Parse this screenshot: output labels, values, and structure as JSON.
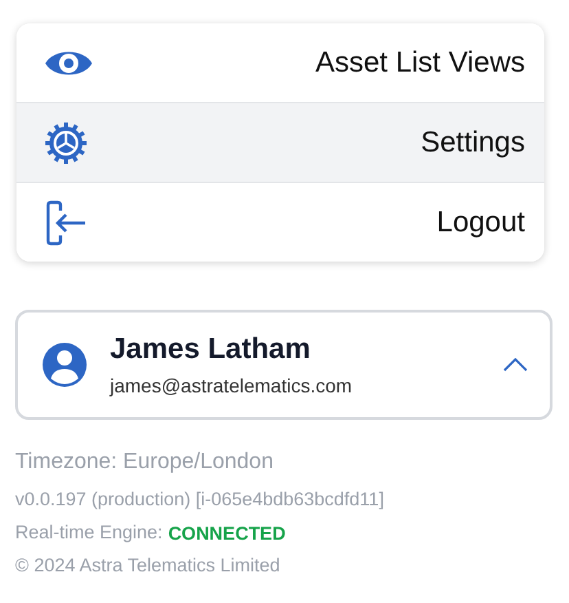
{
  "menu": {
    "items": [
      {
        "kind": "eye",
        "label": "Asset List Views",
        "selected": false
      },
      {
        "kind": "gear",
        "label": "Settings",
        "selected": true
      },
      {
        "kind": "logout",
        "label": "Logout",
        "selected": false
      }
    ]
  },
  "profile": {
    "name": "James Latham",
    "email": "james@astratelematics.com",
    "expanded": true
  },
  "footer": {
    "timezone": "Timezone: Europe/London",
    "version": "v0.0.197 (production) [i-065e4bdb63bcdfd11]",
    "engine_label": "Real-time Engine:",
    "engine_status": "CONNECTED",
    "connected": true,
    "copyright": "© 2024 Astra Telematics Limited"
  }
}
